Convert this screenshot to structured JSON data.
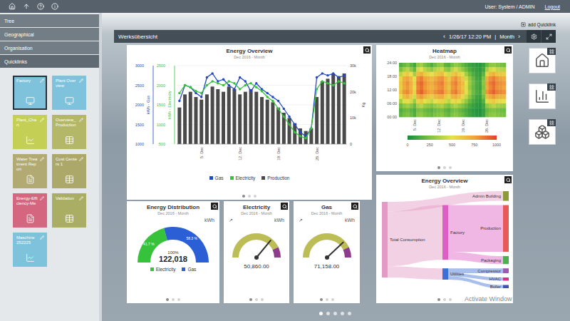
{
  "topbar": {
    "user": "User: System / ADMIN",
    "logout": "Logout"
  },
  "sidebar": {
    "sections": [
      {
        "label": "Tree",
        "expanded": false
      },
      {
        "label": "Geographical",
        "expanded": false
      },
      {
        "label": "Organisation",
        "expanded": false
      },
      {
        "label": "Quicklinks",
        "expanded": true
      }
    ],
    "quicklinks": [
      {
        "label": "Factory",
        "color": "#7ec3db",
        "selected": true,
        "kind": "monitor"
      },
      {
        "label": "Plant Overview",
        "color": "#7ec3db",
        "selected": false,
        "kind": "monitor"
      },
      {
        "label": "Plant_Chart",
        "color": "#c3d055",
        "selected": false,
        "kind": "chart"
      },
      {
        "label": "Overview_Production",
        "color": "#b3b767",
        "selected": false,
        "kind": "table"
      },
      {
        "label": "Water Treatment Report",
        "color": "#b1aa72",
        "selected": false,
        "kind": "report"
      },
      {
        "label": "Cost Centers 1",
        "color": "#aca86a",
        "selected": false,
        "kind": "table"
      },
      {
        "label": "Energy-Efficiency-Me",
        "color": "#d4667f",
        "selected": false,
        "kind": "report"
      },
      {
        "label": "Validation",
        "color": "#aaae64",
        "selected": false,
        "kind": "table"
      },
      {
        "label": "Maschine 252225",
        "color": "#7ec3db",
        "selected": false,
        "kind": "chart"
      }
    ]
  },
  "main": {
    "add_quicklink": "add Quicklink",
    "title": "Werksübersicht",
    "prev": "‹",
    "date": "1/26/17 12:20 PM",
    "separator": "|",
    "period": "Month",
    "next": "›",
    "pages": [
      {
        "selected": true
      },
      {
        "selected": false
      },
      {
        "selected": false
      },
      {
        "selected": false
      },
      {
        "selected": false
      }
    ]
  },
  "energy_overview": {
    "title": "Energy Overview",
    "subtitle": "Dec 2016 - Month",
    "axes": {
      "gas": {
        "title": "kWh - Gas",
        "ticks": [
          "3000",
          "2500",
          "2000",
          "1500",
          "1000"
        ],
        "min": 1000,
        "max": 3000
      },
      "electricity": {
        "title": "kWh - Electricity",
        "ticks": [
          "2500",
          "2000",
          "1500",
          "1000",
          "500"
        ],
        "min": 500,
        "max": 2500
      },
      "production": {
        "title": "Kg",
        "ticks": [
          "30k",
          "20k",
          "10k",
          "0"
        ],
        "min": 0,
        "max": 30000
      }
    },
    "x_labels": [
      {
        "label": "5. Dec",
        "day": 5
      },
      {
        "label": "12. Dec",
        "day": 12
      },
      {
        "label": "19. Dec",
        "day": 19
      },
      {
        "label": "26. Dec",
        "day": 26
      }
    ],
    "series": [
      {
        "name": "Gas",
        "kind": "line",
        "axis": "gas",
        "color": "#2248c4",
        "values": [
          2100,
          2500,
          2450,
          2300,
          2200,
          2700,
          2800,
          2600,
          2650,
          2500,
          2400,
          2700,
          2600,
          2350,
          2550,
          2400,
          2300,
          2200,
          2100,
          1900,
          1700,
          1500,
          1300,
          1200,
          1400,
          2700,
          2800,
          2750,
          2800,
          2700,
          2750
        ]
      },
      {
        "name": "Electricity",
        "kind": "line",
        "axis": "electricity",
        "color": "#36c23a",
        "values": [
          1800,
          2000,
          1950,
          1850,
          1800,
          2000,
          2100,
          2050,
          2000,
          2100,
          2050,
          1900,
          2000,
          2050,
          1950,
          1850,
          1700,
          1600,
          1400,
          1200,
          1000,
          800,
          700,
          650,
          900,
          1900,
          2100,
          2050,
          2000,
          2100,
          2050
        ]
      },
      {
        "name": "Production",
        "kind": "bar",
        "axis": "production",
        "color": "#4a4a4a",
        "values": [
          14000,
          19000,
          20000,
          18000,
          17000,
          19000,
          22000,
          21000,
          20000,
          22000,
          21000,
          19000,
          20000,
          21000,
          20000,
          18000,
          17000,
          16000,
          14000,
          12000,
          10000,
          8000,
          6000,
          5000,
          6000,
          18000,
          24000,
          25000,
          27000,
          26000,
          27000
        ]
      }
    ],
    "pages": [
      {
        "selected": true
      },
      {
        "selected": false
      },
      {
        "selected": false
      }
    ]
  },
  "heatmap": {
    "title": "Heatmap",
    "subtitle": "Dec 2016 - Month",
    "y_ticks": [
      "24:00",
      "18:00",
      "12:00",
      "06:00",
      "00:00"
    ],
    "x_labels": [
      {
        "label": "5. Dec",
        "day": 5
      },
      {
        "label": "12. Dec",
        "day": 12
      },
      {
        "label": "19. Dec",
        "day": 19
      },
      {
        "label": "26. Dec",
        "day": 26
      }
    ],
    "scale": [
      {
        "label": "0",
        "value": 0,
        "color": "#138d3d"
      },
      {
        "label": "250",
        "value": 250,
        "color": "#7cc242"
      },
      {
        "label": "500",
        "value": 500,
        "color": "#e6e14a"
      },
      {
        "label": "750",
        "value": 750,
        "color": "#f0a43a"
      },
      {
        "label": "1000",
        "value": 1000,
        "color": "#e0412b"
      }
    ],
    "rows": [
      [
        150,
        200,
        250,
        180,
        120,
        300,
        350,
        250,
        200,
        150,
        220,
        280,
        300,
        180,
        160,
        240,
        300,
        260,
        200,
        150,
        100,
        80,
        60,
        50,
        90,
        200,
        280,
        300,
        260,
        240,
        220
      ],
      [
        250,
        350,
        400,
        300,
        200,
        450,
        500,
        400,
        350,
        300,
        380,
        420,
        450,
        320,
        280,
        400,
        460,
        380,
        300,
        220,
        150,
        100,
        80,
        60,
        120,
        350,
        450,
        480,
        420,
        400,
        380
      ],
      [
        400,
        550,
        600,
        500,
        350,
        650,
        700,
        600,
        550,
        500,
        580,
        620,
        650,
        520,
        450,
        600,
        650,
        560,
        480,
        350,
        220,
        150,
        100,
        80,
        180,
        550,
        650,
        700,
        620,
        600,
        580
      ],
      [
        550,
        700,
        750,
        650,
        500,
        800,
        850,
        750,
        700,
        650,
        720,
        780,
        800,
        680,
        600,
        750,
        800,
        700,
        600,
        450,
        300,
        200,
        120,
        100,
        250,
        700,
        800,
        850,
        780,
        750,
        720
      ],
      [
        600,
        750,
        800,
        700,
        550,
        850,
        900,
        800,
        750,
        700,
        780,
        820,
        850,
        720,
        650,
        800,
        850,
        750,
        650,
        500,
        320,
        220,
        140,
        110,
        280,
        750,
        850,
        900,
        820,
        800,
        780
      ],
      [
        580,
        720,
        780,
        680,
        520,
        820,
        880,
        780,
        720,
        680,
        750,
        800,
        820,
        700,
        620,
        780,
        820,
        720,
        620,
        480,
        300,
        200,
        130,
        100,
        260,
        720,
        820,
        880,
        800,
        780,
        750
      ],
      [
        620,
        780,
        820,
        720,
        560,
        860,
        920,
        820,
        760,
        720,
        800,
        840,
        860,
        740,
        660,
        820,
        860,
        760,
        660,
        520,
        340,
        220,
        150,
        120,
        290,
        780,
        860,
        920,
        840,
        820,
        800
      ],
      [
        500,
        650,
        700,
        600,
        450,
        720,
        780,
        680,
        620,
        580,
        660,
        700,
        720,
        600,
        540,
        680,
        720,
        640,
        540,
        420,
        280,
        180,
        110,
        90,
        230,
        650,
        720,
        780,
        700,
        680,
        660
      ],
      [
        350,
        480,
        520,
        450,
        320,
        550,
        600,
        500,
        460,
        420,
        500,
        540,
        560,
        450,
        400,
        520,
        560,
        480,
        400,
        300,
        200,
        130,
        90,
        70,
        160,
        480,
        560,
        600,
        540,
        520,
        500
      ],
      [
        220,
        300,
        340,
        280,
        200,
        360,
        400,
        320,
        290,
        260,
        320,
        350,
        370,
        290,
        250,
        330,
        370,
        310,
        260,
        200,
        130,
        90,
        60,
        50,
        110,
        300,
        360,
        400,
        350,
        330,
        320
      ],
      [
        150,
        200,
        220,
        180,
        130,
        240,
        260,
        210,
        190,
        170,
        210,
        230,
        240,
        190,
        160,
        220,
        240,
        200,
        170,
        130,
        90,
        60,
        40,
        30,
        80,
        200,
        240,
        260,
        230,
        220,
        210
      ],
      [
        180,
        230,
        260,
        210,
        150,
        280,
        300,
        250,
        220,
        200,
        250,
        270,
        280,
        220,
        190,
        260,
        280,
        240,
        200,
        150,
        100,
        70,
        50,
        40,
        90,
        230,
        280,
        300,
        270,
        250,
        240
      ]
    ],
    "pages": [
      {
        "selected": true
      },
      {
        "selected": false
      },
      {
        "selected": false
      }
    ]
  },
  "sankey": {
    "title": "Energy Overview",
    "subtitle": "Dec 2016 - Month",
    "nodes": [
      {
        "name": "Total Consumption",
        "color": "#e49ac4"
      },
      {
        "name": "Factory",
        "color": "#dd5fc6"
      },
      {
        "name": "Utilities",
        "color": "#3d6fd6"
      },
      {
        "name": "Admin Building",
        "color": "#8c9a3a"
      },
      {
        "name": "Production",
        "color": "#e85a5a"
      },
      {
        "name": "Packaging",
        "color": "#4caf50"
      },
      {
        "name": "Compressor",
        "color": "#9b59b6"
      },
      {
        "name": "HVAC",
        "color": "#d63384"
      },
      {
        "name": "Boiler",
        "color": "#3f51b5"
      }
    ],
    "links": [
      {
        "source": "Total Consumption",
        "target": "Admin Building",
        "value": 12
      },
      {
        "source": "Total Consumption",
        "target": "Factory",
        "value": 68
      },
      {
        "source": "Total Consumption",
        "target": "Utilities",
        "value": 14
      },
      {
        "source": "Factory",
        "target": "Production",
        "value": 58
      },
      {
        "source": "Factory",
        "target": "Packaging",
        "value": 10
      },
      {
        "source": "Utilities",
        "target": "Compressor",
        "value": 6
      },
      {
        "source": "Utilities",
        "target": "HVAC",
        "value": 4
      },
      {
        "source": "Utilities",
        "target": "Boiler",
        "value": 4
      }
    ],
    "pages": [
      {
        "selected": true
      },
      {
        "selected": false
      },
      {
        "selected": false
      }
    ]
  },
  "distribution": {
    "title": "Energy Distribution",
    "subtitle": "Dec 2016 - Month",
    "unit": "kWh",
    "center_label": "100%",
    "total": "122,018",
    "segments": [
      {
        "name": "Electricity",
        "share": 0.417,
        "label": "41.7 %",
        "color": "#36c23a"
      },
      {
        "name": "Gas",
        "share": 0.583,
        "label": "58.3 %",
        "color": "#2a5fd6"
      }
    ],
    "pages": [
      {
        "selected": true
      },
      {
        "selected": false
      },
      {
        "selected": false
      }
    ]
  },
  "gauges": [
    {
      "title": "Electricity",
      "subtitle": "Dec 2016 - Month",
      "unit": "kWh",
      "trend": "↗",
      "value": "50,860.00",
      "level": 0.72,
      "bands": [
        {
          "to": 0.86,
          "color": "#bcbd55"
        },
        {
          "to": 1,
          "color": "#8e3b8e"
        }
      ],
      "pages": [
        {
          "selected": true
        },
        {
          "selected": false
        },
        {
          "selected": false
        }
      ]
    },
    {
      "title": "Gas",
      "subtitle": "Dec 2016 - Month",
      "unit": "kWh",
      "trend": "↗",
      "value": "71,158.00",
      "level": 0.76,
      "bands": [
        {
          "to": 0.86,
          "color": "#bcbd55"
        },
        {
          "to": 1,
          "color": "#8e3b8e"
        }
      ],
      "pages": [
        {
          "selected": true
        },
        {
          "selected": false
        },
        {
          "selected": false
        }
      ]
    }
  ],
  "shortcuts": [
    {
      "kind": "home"
    },
    {
      "kind": "chart"
    },
    {
      "kind": "boxes"
    }
  ],
  "watermark": "Activate Window"
}
